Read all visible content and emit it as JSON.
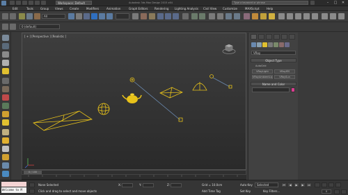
{
  "titlebar": {
    "workspace": "Workspace: Default",
    "app_title": "Autodesk 3ds Max Design 2015 x64",
    "search_placeholder": "Type a keyword or phrase",
    "minimize": "–",
    "maximize": "□",
    "close": "✕"
  },
  "menu": [
    "Edit",
    "Tools",
    "Group",
    "Views",
    "Create",
    "Modifiers",
    "Animation",
    "Graph Editors",
    "Rendering",
    "Lighting Analysis",
    "Civil View",
    "Customize",
    "MAXScript",
    "Help"
  ],
  "toolbar": {
    "selection_filter": "All",
    "layer": "0 (default)"
  },
  "viewport": {
    "label": "[ + ] [Perspective ] [Realistic ]"
  },
  "time_slider": {
    "position": "0 / 100"
  },
  "command_panel": {
    "renderer": "VRay",
    "object_type_title": "Object Type",
    "autogrid": "AutoGrid",
    "buttons": [
      "VRayLight",
      "VRayIES",
      "VRayAmbientLig",
      "VRaySun"
    ],
    "name_color_title": "Name and Color",
    "accent_color": "#d93d8f"
  },
  "status": {
    "maxscript": "Welcome to M",
    "selected": "None Selected",
    "prompt": "Click and drag to select and move objects",
    "x_label": "X:",
    "y_label": "Y:",
    "z_label": "Z:",
    "grid": "Grid = 10.0cm",
    "add_time_tag": "Add Time Tag",
    "auto_key": "Auto Key",
    "set_key": "Set Key",
    "selected_dropdown": "Selected",
    "key_filters": "Key Filters...",
    "frame": "0"
  },
  "colors": {
    "selection_yellow": "#e8c21a",
    "viewport_bg_top": "#3e3e3e",
    "viewport_bg_bottom": "#2a2a2a"
  }
}
